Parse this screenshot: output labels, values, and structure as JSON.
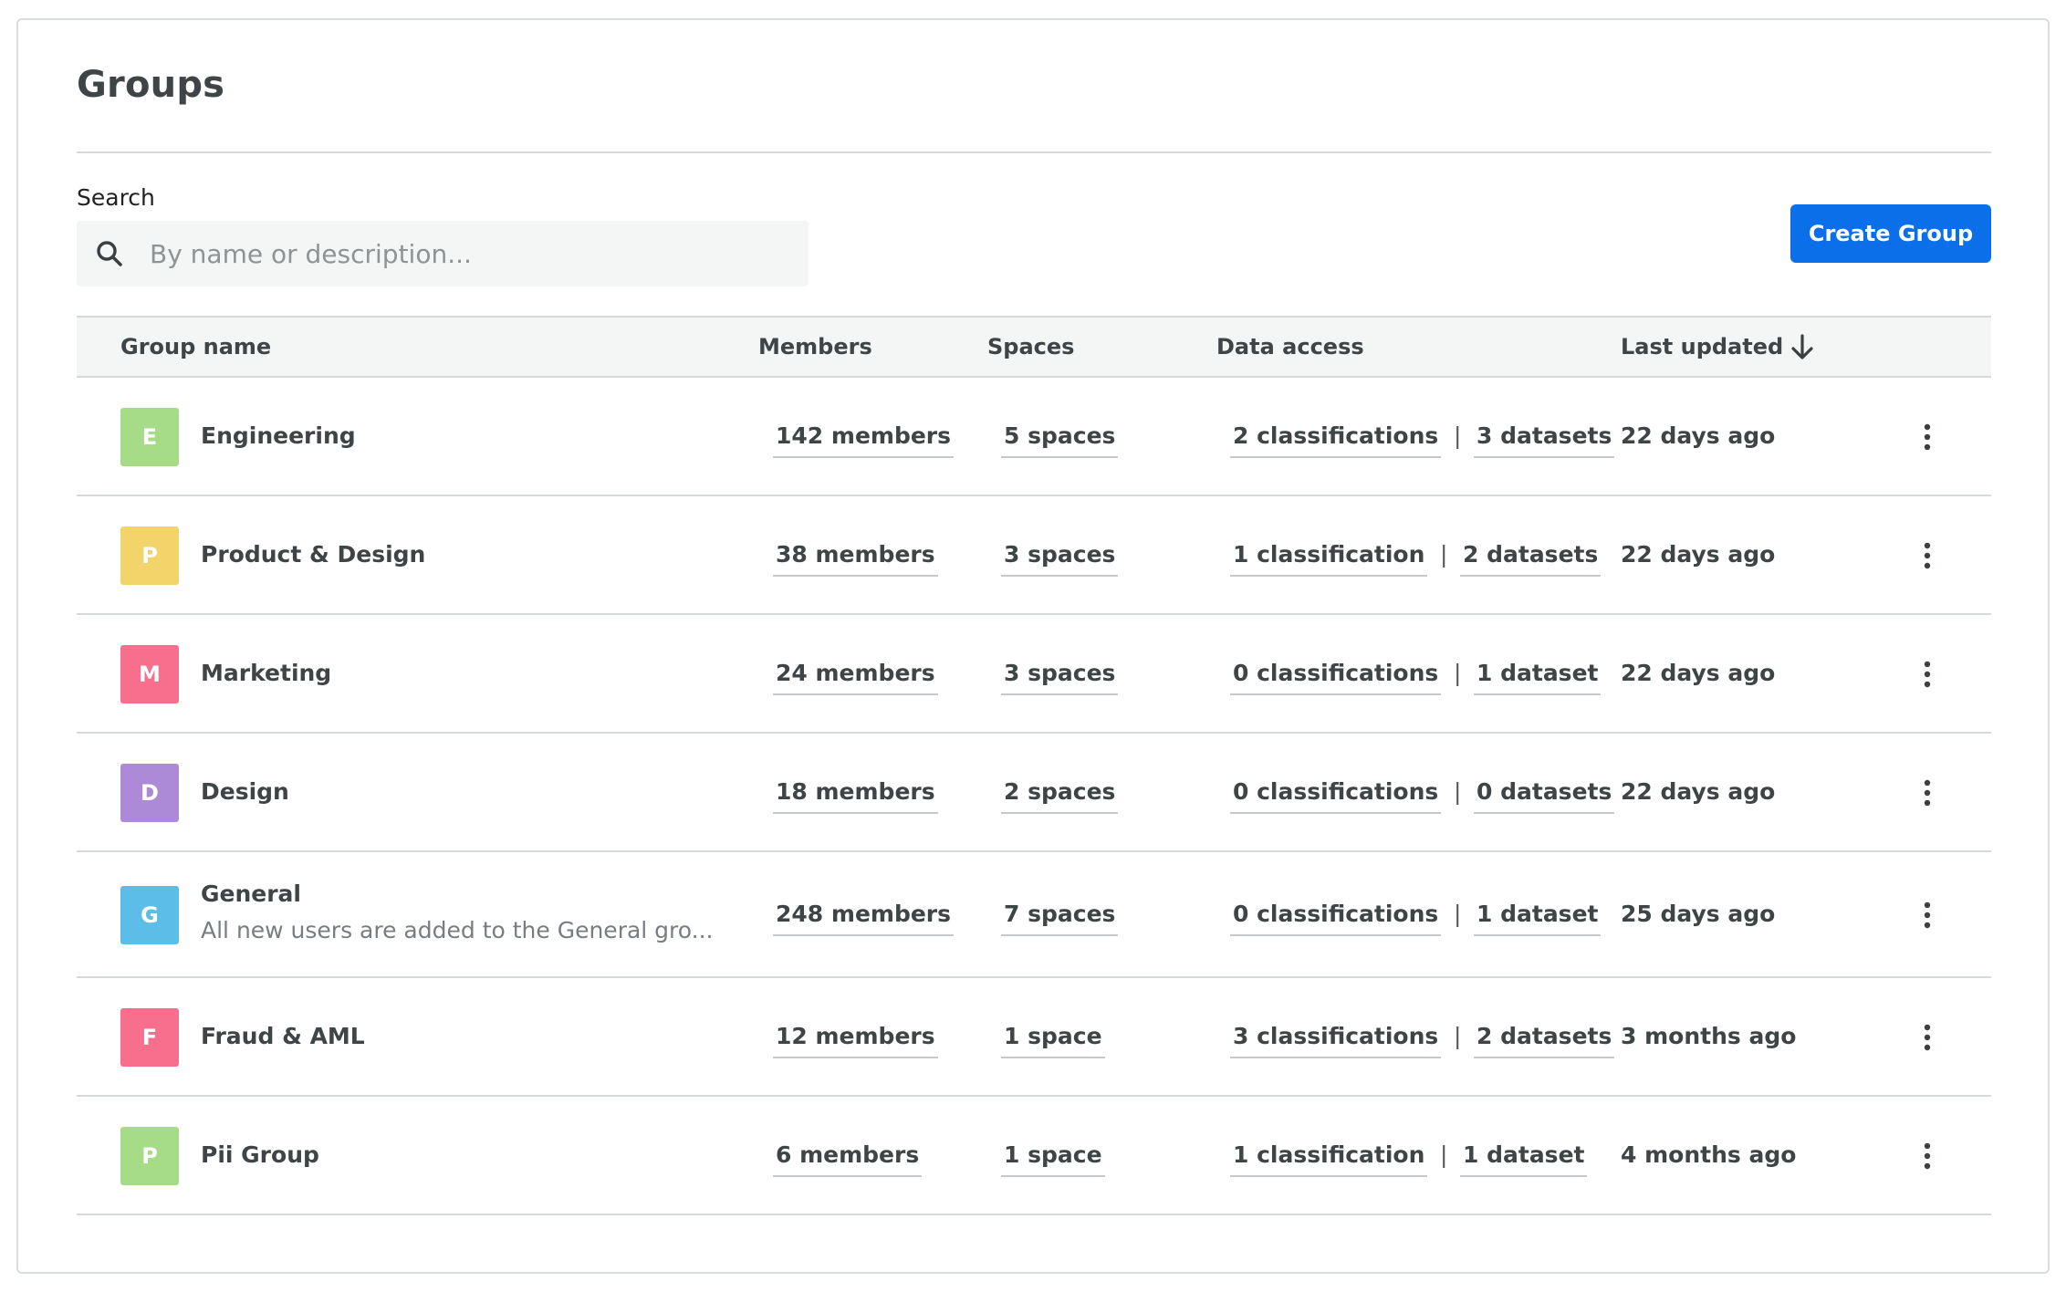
{
  "page": {
    "title": "Groups"
  },
  "search": {
    "label": "Search",
    "placeholder": "By name or description..."
  },
  "toolbar": {
    "create_label": "Create Group"
  },
  "colors": {
    "accent": "#0a6fe8",
    "green": "#a6dc87",
    "yellow": "#f3d46b",
    "pink": "#f76f8d",
    "purple": "#ad8ad7",
    "blue": "#5cbde9"
  },
  "table": {
    "headers": {
      "name": "Group name",
      "members": "Members",
      "spaces": "Spaces",
      "data_access": "Data access",
      "last_updated": "Last updated"
    },
    "sort": {
      "column": "last_updated",
      "direction": "descending",
      "icon": "arrow-down-icon"
    },
    "separator": "|",
    "rows": [
      {
        "initial": "E",
        "color": "#a6dc87",
        "name": "Engineering",
        "description": "",
        "members": "142 members",
        "spaces": "5 spaces",
        "classifications": "2 classifications",
        "datasets": "3 datasets",
        "updated": "22 days ago"
      },
      {
        "initial": "P",
        "color": "#f3d46b",
        "name": "Product & Design",
        "description": "",
        "members": "38 members",
        "spaces": "3 spaces",
        "classifications": "1 classification",
        "datasets": "2 datasets",
        "updated": "22 days ago"
      },
      {
        "initial": "M",
        "color": "#f76f8d",
        "name": "Marketing",
        "description": "",
        "members": "24 members",
        "spaces": "3 spaces",
        "classifications": "0 classifications",
        "datasets": "1 dataset",
        "updated": "22 days ago"
      },
      {
        "initial": "D",
        "color": "#ad8ad7",
        "name": "Design",
        "description": "",
        "members": "18 members",
        "spaces": "2 spaces",
        "classifications": "0 classifications",
        "datasets": "0 datasets",
        "updated": "22 days ago"
      },
      {
        "initial": "G",
        "color": "#5cbde9",
        "name": "General",
        "description": "All new users are added to the General gro...",
        "members": "248 members",
        "spaces": "7 spaces",
        "classifications": "0 classifications",
        "datasets": "1 dataset",
        "updated": "25 days ago"
      },
      {
        "initial": "F",
        "color": "#f76f8d",
        "name": "Fraud & AML",
        "description": "",
        "members": "12 members",
        "spaces": "1 space",
        "classifications": "3 classifications",
        "datasets": "2 datasets",
        "updated": "3 months ago"
      },
      {
        "initial": "P",
        "color": "#a6dc87",
        "name": "Pii Group",
        "description": "",
        "members": "6 members",
        "spaces": "1 space",
        "classifications": "1 classification",
        "datasets": "1 dataset",
        "updated": "4 months ago"
      }
    ]
  }
}
